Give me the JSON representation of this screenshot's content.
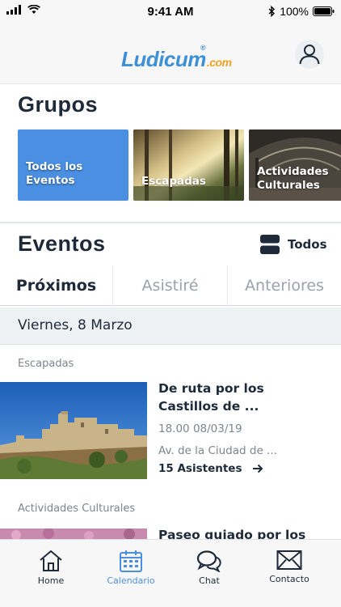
{
  "status_bar": {
    "time": "9:41 AM",
    "battery": "100%"
  },
  "header": {
    "logo_main": "Ludicum",
    "logo_suffix": ".com",
    "logo_reg": "®",
    "profile_icon": "user-icon"
  },
  "grupos": {
    "title": "Grupos",
    "cards": [
      {
        "label": "Todos los Eventos"
      },
      {
        "label": "Escapadas"
      },
      {
        "label": "Actividades Culturales"
      }
    ]
  },
  "eventos": {
    "title": "Eventos",
    "filter_label": "Todos",
    "tabs": [
      "Próximos",
      "Asistiré",
      "Anteriores"
    ],
    "active_tab": "Próximos",
    "date": "Viernes, 8 Marzo",
    "items": [
      {
        "category": "Escapadas",
        "title_line1": "De ruta por los",
        "title_line2": "Castillos de ...",
        "time_date": "18.00  08/03/19",
        "address": "Av. de la Ciudad de ...",
        "attendees": "15 Asistentes"
      },
      {
        "category": "Actividades Culturales",
        "title_line1": "Paseo guiado por los"
      }
    ]
  },
  "tab_bar": {
    "items": [
      {
        "label": "Home",
        "icon": "home-icon"
      },
      {
        "label": "Calendario",
        "icon": "calendar-icon"
      },
      {
        "label": "Chat",
        "icon": "chat-icon"
      },
      {
        "label": "Contacto",
        "icon": "mail-icon"
      }
    ],
    "active": "Calendario",
    "accent_color": "#4a8fe1"
  }
}
